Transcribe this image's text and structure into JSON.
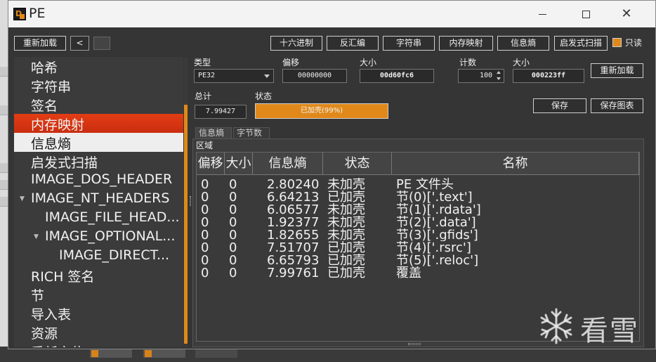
{
  "window": {
    "title": "PE"
  },
  "toolbar": {
    "reload": "重新加载",
    "back": "<",
    "buttons": [
      "十六进制",
      "反汇编",
      "字符串",
      "内存映射",
      "信息熵",
      "启发式扫描"
    ],
    "readonly_label": "只读",
    "readonly_checked": true
  },
  "sidebar": {
    "items": [
      {
        "label": "哈希",
        "indent": 0
      },
      {
        "label": "字符串",
        "indent": 0
      },
      {
        "label": "签名",
        "indent": 0
      },
      {
        "label": "内存映射",
        "indent": 0,
        "state": "active"
      },
      {
        "label": "信息熵",
        "indent": 0,
        "state": "selected"
      },
      {
        "label": "启发式扫描",
        "indent": 0
      },
      {
        "label": "IMAGE_DOS_HEADER",
        "indent": 0
      },
      {
        "label": "IMAGE_NT_HEADERS",
        "indent": 0,
        "expanded": true
      },
      {
        "label": "IMAGE_FILE_HEAD...",
        "indent": 1
      },
      {
        "label": "IMAGE_OPTIONAL...",
        "indent": 1,
        "expanded": true
      },
      {
        "label": "IMAGE_DIRECT...",
        "indent": 2
      },
      {
        "label": "RICH 签名",
        "indent": 0
      },
      {
        "label": "节",
        "indent": 0
      },
      {
        "label": "导入表",
        "indent": 0
      },
      {
        "label": "资源",
        "indent": 0
      },
      {
        "label": "重新定位",
        "indent": 0
      }
    ]
  },
  "fields": {
    "type_label": "类型",
    "type_value": "PE32",
    "offset_label": "偏移",
    "offset_value": "00000000",
    "size_label": "大小",
    "size_value": "00d60fc6",
    "count_label": "计数",
    "count_value": "100",
    "size2_label": "大小",
    "size2_value": "000223ff",
    "reload_button": "重新加载",
    "total_label": "总计",
    "total_value": "7.99427",
    "status_label": "状态",
    "status_value": "已加壳(99%)",
    "status_percent": 99,
    "save_button": "保存",
    "save_chart_button": "保存图表"
  },
  "tabs": [
    "信息熵",
    "字节数"
  ],
  "region_label": "区域",
  "table": {
    "columns": [
      "偏移",
      "大小",
      "信息熵",
      "状态",
      "名称"
    ],
    "rows": [
      [
        "0",
        "0",
        "2.80240",
        "未加壳",
        "PE 文件头"
      ],
      [
        "0",
        "0",
        "6.64213",
        "已加壳",
        "节(0)['.text']"
      ],
      [
        "0",
        "0",
        "6.06577",
        "未加壳",
        "节(1)['.rdata']"
      ],
      [
        "0",
        "0",
        "1.92377",
        "未加壳",
        "节(2)['.data']"
      ],
      [
        "0",
        "0",
        "1.82655",
        "未加壳",
        "节(3)['.gfids']"
      ],
      [
        "0",
        "0",
        "7.51707",
        "已加壳",
        "节(4)['.rsrc']"
      ],
      [
        "0",
        "0",
        "6.65793",
        "已加壳",
        "节(5)['.reloc']"
      ],
      [
        "0",
        "0",
        "7.99761",
        "已加壳",
        "覆盖"
      ]
    ]
  },
  "watermark": {
    "text": "看雪"
  },
  "colors": {
    "accent": "#e0891a",
    "active_item": "#d9361a",
    "window_bg": "#353535"
  }
}
